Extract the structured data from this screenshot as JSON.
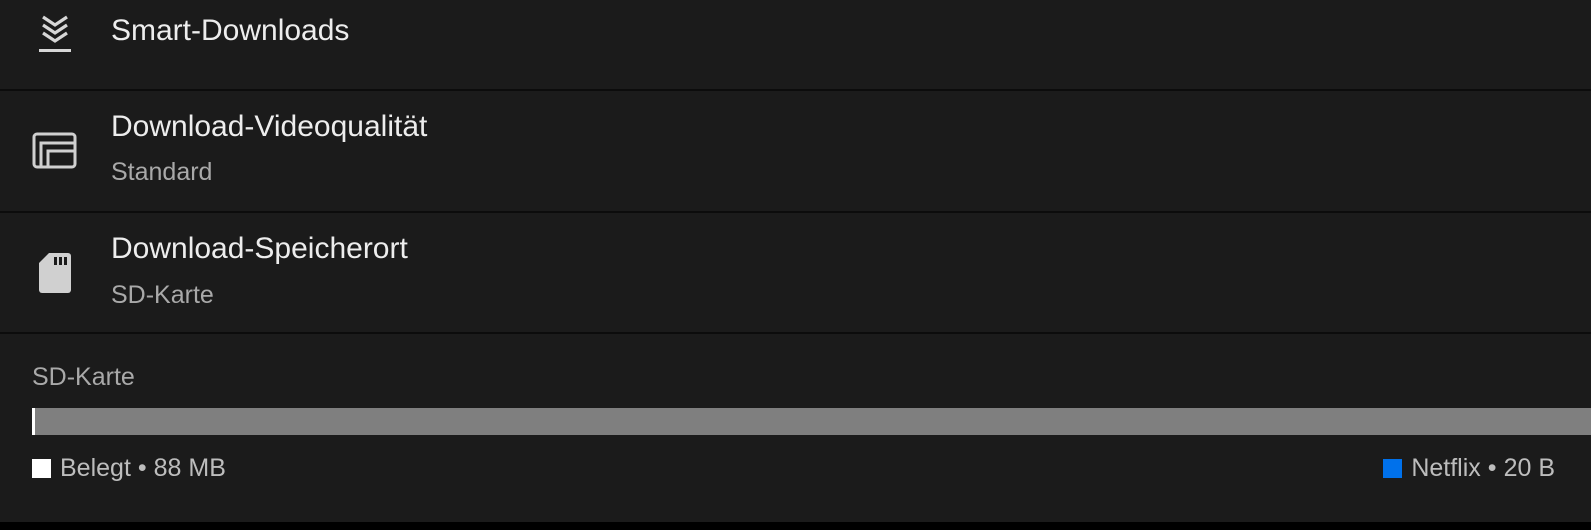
{
  "settings": {
    "smart_downloads": {
      "title": "Smart-Downloads",
      "icon": "smart-downloads-icon"
    },
    "video_quality": {
      "title": "Download-Videoqualität",
      "value": "Standard",
      "icon": "video-quality-icon"
    },
    "storage_location": {
      "title": "Download-Speicherort",
      "value": "SD-Karte",
      "icon": "sd-card-icon"
    }
  },
  "storage": {
    "label": "SD-Karte",
    "used_fraction": 0.002,
    "app_fraction": 0.0,
    "used": {
      "label": "Belegt",
      "amount": "88 MB",
      "color": "#ffffff"
    },
    "app": {
      "label": "Netflix",
      "amount": "20 B",
      "color": "#0071eb"
    },
    "free_color": "#7f7f7f"
  },
  "colors": {
    "background": "#1b1b1b",
    "divider": "#0c0c0c",
    "title_text": "#ededed",
    "secondary_text": "#a9a9a9"
  }
}
